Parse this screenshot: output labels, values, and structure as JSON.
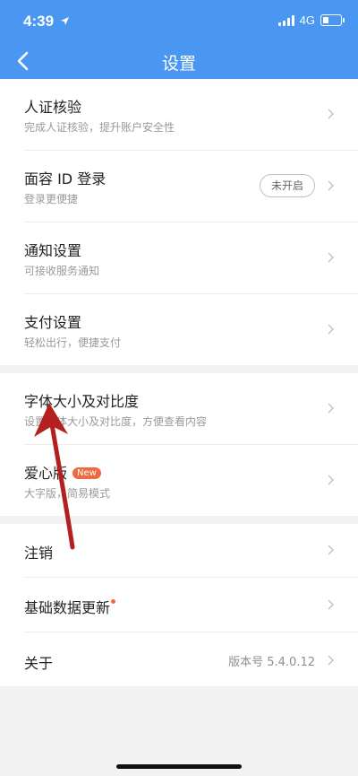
{
  "status_bar": {
    "time": "4:39",
    "network": "4G"
  },
  "header": {
    "title": "设置",
    "back_icon": "chevron-left-icon"
  },
  "groups": [
    {
      "items": [
        {
          "label": "人证核验",
          "sublabel": "完成人证核验，提升账户安全性"
        },
        {
          "label": "面容 ID 登录",
          "sublabel": "登录更便捷",
          "status_pill": "未开启"
        },
        {
          "label": "通知设置",
          "sublabel": "可接收服务通知"
        },
        {
          "label": "支付设置",
          "sublabel": "轻松出行，便捷支付"
        }
      ]
    },
    {
      "items": [
        {
          "label": "字体大小及对比度",
          "sublabel": "设置字体大小及对比度，方便查看内容"
        },
        {
          "label": "爱心版",
          "badge": "New",
          "sublabel": "大字版，简易模式"
        }
      ]
    },
    {
      "items": [
        {
          "label": "注销"
        },
        {
          "label": "基础数据更新"
        },
        {
          "label": "关于",
          "value": "版本号 5.4.0.12"
        }
      ]
    }
  ],
  "colors": {
    "header_bg": "#4a97f1",
    "badge": "#f06a40",
    "annotation_arrow": "#b3201f"
  }
}
